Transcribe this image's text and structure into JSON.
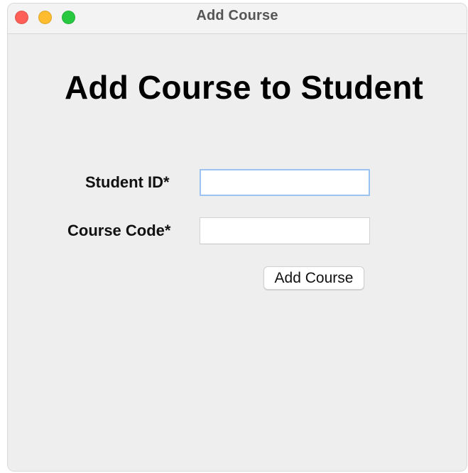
{
  "window": {
    "title": "Add Course",
    "controls": {
      "close_icon": "close-window-icon",
      "minimize_icon": "minimize-window-icon",
      "zoom_icon": "zoom-window-icon"
    },
    "colors": {
      "close": "#ff5f57",
      "minimize": "#febc2e",
      "zoom": "#28c840"
    }
  },
  "page": {
    "title": "Add Course to Student"
  },
  "form": {
    "student_id": {
      "label": "Student ID*",
      "value": "",
      "placeholder": ""
    },
    "course_code": {
      "label": "Course Code*",
      "value": "",
      "placeholder": ""
    },
    "submit_label": "Add Course"
  }
}
